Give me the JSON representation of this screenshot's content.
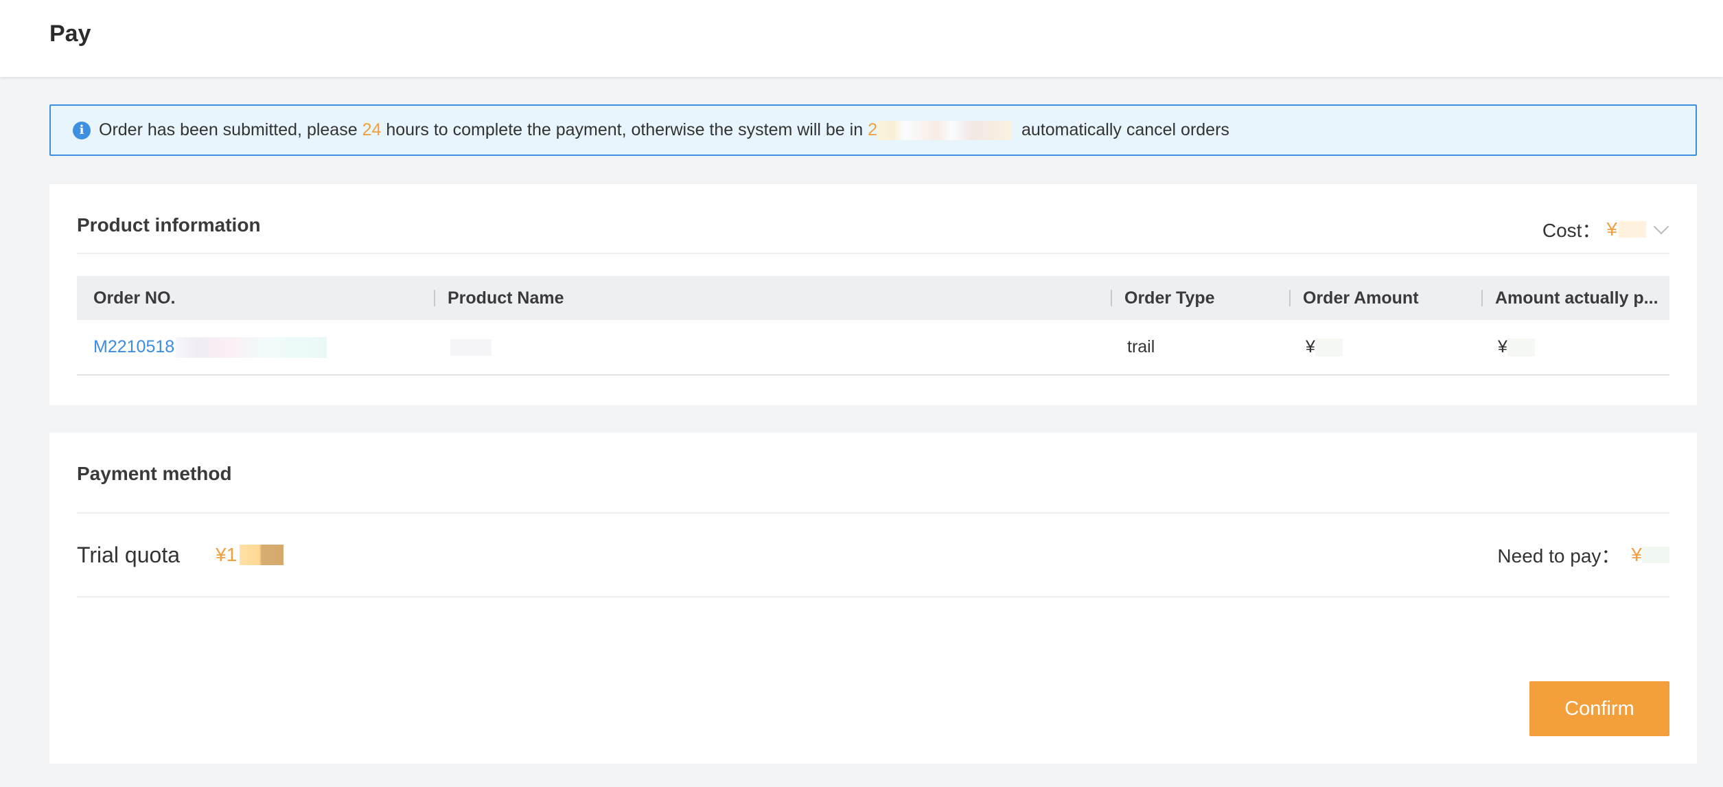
{
  "header": {
    "title": "Pay"
  },
  "alert": {
    "part1": "Order has been submitted, please",
    "hours": "24",
    "part2": "hours to complete the payment, otherwise the system will be in",
    "deadline_prefix": "2",
    "part3": "automatically cancel orders"
  },
  "product": {
    "title": "Product information",
    "cost_label": "Cost：",
    "cost_value": "¥",
    "table": {
      "headers": [
        "Order NO.",
        "Product Name",
        "Order Type",
        "Order Amount",
        "Amount actually p..."
      ],
      "rows": [
        {
          "order_no": "M2210518",
          "product_name": "",
          "order_type": "trail",
          "order_amount": "¥",
          "amount_paid": "¥"
        }
      ]
    }
  },
  "payment": {
    "title": "Payment method",
    "quota_label": "Trial quota",
    "quota_value": "¥1",
    "need_to_pay_label": "Need to pay：",
    "need_to_pay_value": "¥",
    "confirm_label": "Confirm"
  },
  "colors": {
    "accent": "#f3a03c",
    "link": "#3c8de0",
    "info": "#3d8fe2"
  }
}
